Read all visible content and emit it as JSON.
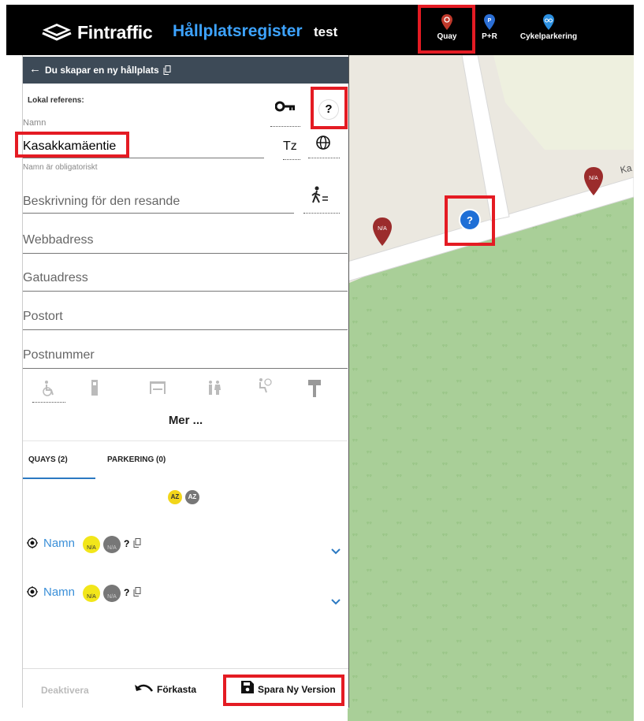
{
  "header": {
    "brand": "Fintraffic",
    "app_title": "Hållplatsregister",
    "env": "test",
    "buttons": [
      {
        "label": "Quay",
        "icon": "quay-marker-icon",
        "color": "#c0392b"
      },
      {
        "label": "P+R",
        "icon": "parking-marker-icon",
        "color": "#2b6fd6"
      },
      {
        "label": "Cykelparkering",
        "icon": "bike-parking-marker-icon",
        "color": "#2b8fe0"
      }
    ]
  },
  "panel": {
    "title": "Du skapar en ny hållplats",
    "local_ref_label": "Lokal referens:",
    "name_label": "Namn",
    "name_value": "Kasakkamäentie",
    "name_hint": "Namn är obligatoriskt",
    "tz_label": "Tz",
    "description_placeholder": "Beskrivning för den resande",
    "web_placeholder": "Webbadress",
    "street_placeholder": "Gatuadress",
    "city_placeholder": "Postort",
    "postcode_placeholder": "Postnummer",
    "more_label": "Mer ...",
    "tabs": [
      {
        "label": "QUAYS (2)"
      },
      {
        "label": "PARKERING (0)"
      }
    ],
    "quays": [
      {
        "name": "Namn",
        "badge1": "N/A",
        "badge2": "N/A",
        "q": "?"
      },
      {
        "name": "Namn",
        "badge1": "N/A",
        "badge2": "N/A",
        "q": "?"
      }
    ],
    "footer": {
      "deactivate": "Deaktivera",
      "discard": "Förkasta",
      "save": "Spara Ny Version"
    }
  },
  "map": {
    "road_label": "Ka",
    "markers": [
      {
        "label": "N/A",
        "color": "#9b2c2c"
      },
      {
        "label": "N/A",
        "color": "#9b2c2c"
      },
      {
        "label": "?",
        "color": "#1f6fd6"
      }
    ]
  },
  "colors": {
    "accent_blue": "#3da3ff",
    "highlight": "#e41b23",
    "sort_active": "#f2d61a"
  }
}
